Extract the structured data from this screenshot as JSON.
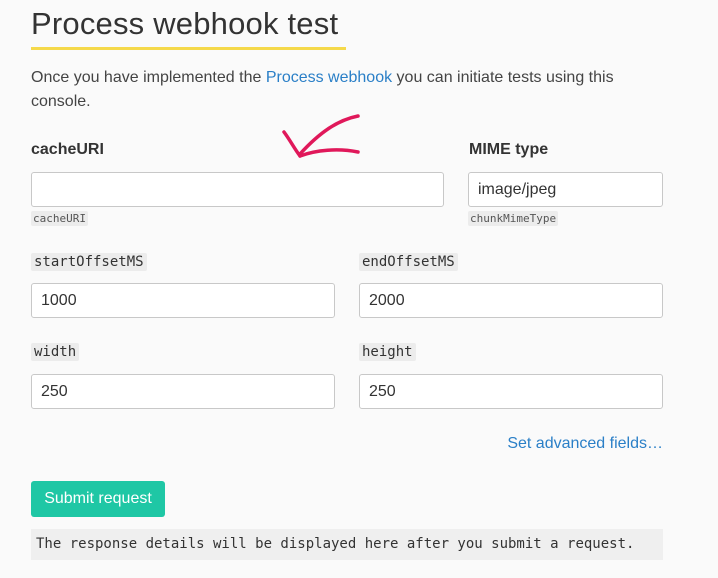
{
  "page": {
    "title": "Process webhook test",
    "intro_before": "Once you have implemented the ",
    "intro_link": "Process webhook",
    "intro_after": " you can initiate tests using this console."
  },
  "form": {
    "cache_uri": {
      "label": "cacheURI",
      "value": "",
      "hint": "cacheURI"
    },
    "mime_type": {
      "label": "MIME type",
      "value": "image/jpeg",
      "hint": "chunkMimeType"
    },
    "start_offset": {
      "label": "startOffsetMS",
      "value": "1000"
    },
    "end_offset": {
      "label": "endOffsetMS",
      "value": "2000"
    },
    "width": {
      "label": "width",
      "value": "250"
    },
    "height": {
      "label": "height",
      "value": "250"
    },
    "advanced_link": "Set advanced fields…",
    "submit_label": "Submit request"
  },
  "response": {
    "text": "The response details will be displayed here after you submit a request."
  },
  "colors": {
    "accent_underline": "#f5d94a",
    "link": "#2a7fc7",
    "submit_button": "#1fc7a5",
    "annotation_arrow": "#e0185a"
  }
}
